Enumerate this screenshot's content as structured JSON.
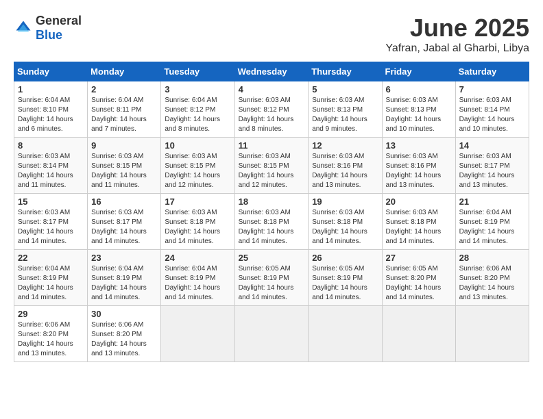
{
  "logo": {
    "general": "General",
    "blue": "Blue"
  },
  "header": {
    "month": "June 2025",
    "location": "Yafran, Jabal al Gharbi, Libya"
  },
  "weekdays": [
    "Sunday",
    "Monday",
    "Tuesday",
    "Wednesday",
    "Thursday",
    "Friday",
    "Saturday"
  ],
  "weeks": [
    [
      {
        "day": "1",
        "sunrise": "6:04 AM",
        "sunset": "8:10 PM",
        "daylight": "14 hours and 6 minutes."
      },
      {
        "day": "2",
        "sunrise": "6:04 AM",
        "sunset": "8:11 PM",
        "daylight": "14 hours and 7 minutes."
      },
      {
        "day": "3",
        "sunrise": "6:04 AM",
        "sunset": "8:12 PM",
        "daylight": "14 hours and 8 minutes."
      },
      {
        "day": "4",
        "sunrise": "6:03 AM",
        "sunset": "8:12 PM",
        "daylight": "14 hours and 8 minutes."
      },
      {
        "day": "5",
        "sunrise": "6:03 AM",
        "sunset": "8:13 PM",
        "daylight": "14 hours and 9 minutes."
      },
      {
        "day": "6",
        "sunrise": "6:03 AM",
        "sunset": "8:13 PM",
        "daylight": "14 hours and 10 minutes."
      },
      {
        "day": "7",
        "sunrise": "6:03 AM",
        "sunset": "8:14 PM",
        "daylight": "14 hours and 10 minutes."
      }
    ],
    [
      {
        "day": "8",
        "sunrise": "6:03 AM",
        "sunset": "8:14 PM",
        "daylight": "14 hours and 11 minutes."
      },
      {
        "day": "9",
        "sunrise": "6:03 AM",
        "sunset": "8:15 PM",
        "daylight": "14 hours and 11 minutes."
      },
      {
        "day": "10",
        "sunrise": "6:03 AM",
        "sunset": "8:15 PM",
        "daylight": "14 hours and 12 minutes."
      },
      {
        "day": "11",
        "sunrise": "6:03 AM",
        "sunset": "8:15 PM",
        "daylight": "14 hours and 12 minutes."
      },
      {
        "day": "12",
        "sunrise": "6:03 AM",
        "sunset": "8:16 PM",
        "daylight": "14 hours and 13 minutes."
      },
      {
        "day": "13",
        "sunrise": "6:03 AM",
        "sunset": "8:16 PM",
        "daylight": "14 hours and 13 minutes."
      },
      {
        "day": "14",
        "sunrise": "6:03 AM",
        "sunset": "8:17 PM",
        "daylight": "14 hours and 13 minutes."
      }
    ],
    [
      {
        "day": "15",
        "sunrise": "6:03 AM",
        "sunset": "8:17 PM",
        "daylight": "14 hours and 14 minutes."
      },
      {
        "day": "16",
        "sunrise": "6:03 AM",
        "sunset": "8:17 PM",
        "daylight": "14 hours and 14 minutes."
      },
      {
        "day": "17",
        "sunrise": "6:03 AM",
        "sunset": "8:18 PM",
        "daylight": "14 hours and 14 minutes."
      },
      {
        "day": "18",
        "sunrise": "6:03 AM",
        "sunset": "8:18 PM",
        "daylight": "14 hours and 14 minutes."
      },
      {
        "day": "19",
        "sunrise": "6:03 AM",
        "sunset": "8:18 PM",
        "daylight": "14 hours and 14 minutes."
      },
      {
        "day": "20",
        "sunrise": "6:03 AM",
        "sunset": "8:18 PM",
        "daylight": "14 hours and 14 minutes."
      },
      {
        "day": "21",
        "sunrise": "6:04 AM",
        "sunset": "8:19 PM",
        "daylight": "14 hours and 14 minutes."
      }
    ],
    [
      {
        "day": "22",
        "sunrise": "6:04 AM",
        "sunset": "8:19 PM",
        "daylight": "14 hours and 14 minutes."
      },
      {
        "day": "23",
        "sunrise": "6:04 AM",
        "sunset": "8:19 PM",
        "daylight": "14 hours and 14 minutes."
      },
      {
        "day": "24",
        "sunrise": "6:04 AM",
        "sunset": "8:19 PM",
        "daylight": "14 hours and 14 minutes."
      },
      {
        "day": "25",
        "sunrise": "6:05 AM",
        "sunset": "8:19 PM",
        "daylight": "14 hours and 14 minutes."
      },
      {
        "day": "26",
        "sunrise": "6:05 AM",
        "sunset": "8:19 PM",
        "daylight": "14 hours and 14 minutes."
      },
      {
        "day": "27",
        "sunrise": "6:05 AM",
        "sunset": "8:20 PM",
        "daylight": "14 hours and 14 minutes."
      },
      {
        "day": "28",
        "sunrise": "6:06 AM",
        "sunset": "8:20 PM",
        "daylight": "14 hours and 13 minutes."
      }
    ],
    [
      {
        "day": "29",
        "sunrise": "6:06 AM",
        "sunset": "8:20 PM",
        "daylight": "14 hours and 13 minutes."
      },
      {
        "day": "30",
        "sunrise": "6:06 AM",
        "sunset": "8:20 PM",
        "daylight": "14 hours and 13 minutes."
      },
      null,
      null,
      null,
      null,
      null
    ]
  ],
  "labels": {
    "sunrise": "Sunrise:",
    "sunset": "Sunset:",
    "daylight": "Daylight hours"
  }
}
